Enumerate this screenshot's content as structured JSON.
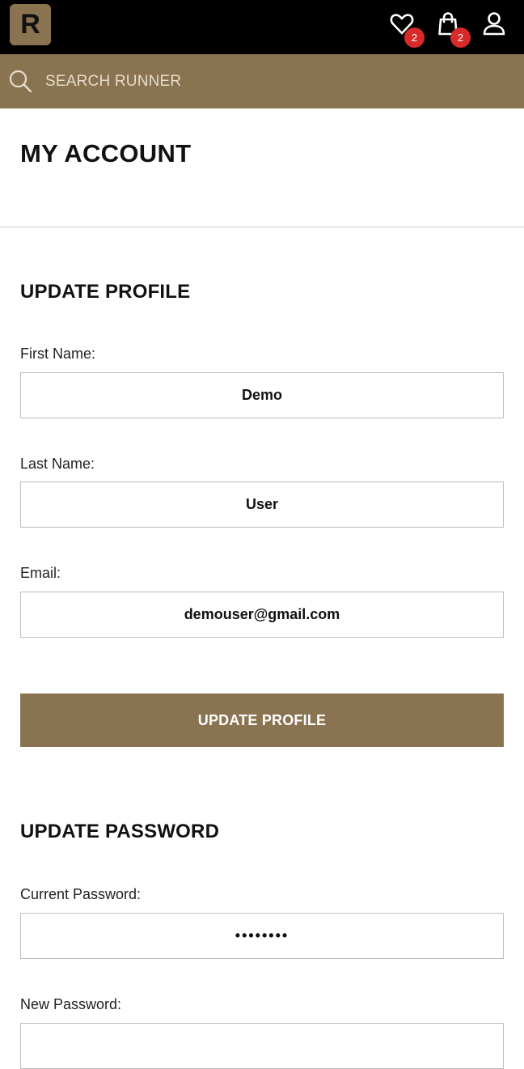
{
  "header": {
    "logo_letter": "R",
    "wishlist_count": "2",
    "cart_count": "2"
  },
  "search": {
    "placeholder": "SEARCH RUNNER"
  },
  "page": {
    "title": "MY ACCOUNT"
  },
  "profile": {
    "section_title": "UPDATE PROFILE",
    "first_name_label": "First Name:",
    "first_name_value": "Demo",
    "last_name_label": "Last Name:",
    "last_name_value": "User",
    "email_label": "Email:",
    "email_value": "demouser@gmail.com",
    "submit_label": "UPDATE PROFILE"
  },
  "password": {
    "section_title": "UPDATE PASSWORD",
    "current_label": "Current Password:",
    "current_value": "••••••••",
    "new_label": "New Password:",
    "new_value": ""
  },
  "colors": {
    "brand": "#8a7350",
    "header_bg": "#000000",
    "badge": "#d72a2a"
  }
}
